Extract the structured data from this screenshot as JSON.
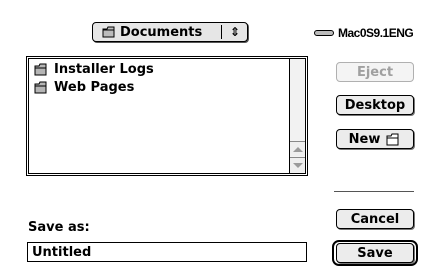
{
  "dialog": {
    "folder_popup": {
      "label": "Documents",
      "arrows": "⇕"
    },
    "volume": {
      "name": "Mac0S9.1ENG",
      "icon": "hard-disk-icon"
    },
    "file_list": {
      "items": [
        {
          "name": "Installer Logs",
          "icon": "folder-icon"
        },
        {
          "name": "Web Pages",
          "icon": "folder-icon"
        }
      ]
    },
    "buttons": {
      "eject": "Eject",
      "desktop": "Desktop",
      "new": "New",
      "cancel": "Cancel",
      "save": "Save"
    },
    "save_as": {
      "label": "Save as:",
      "value": "Untitled"
    }
  }
}
